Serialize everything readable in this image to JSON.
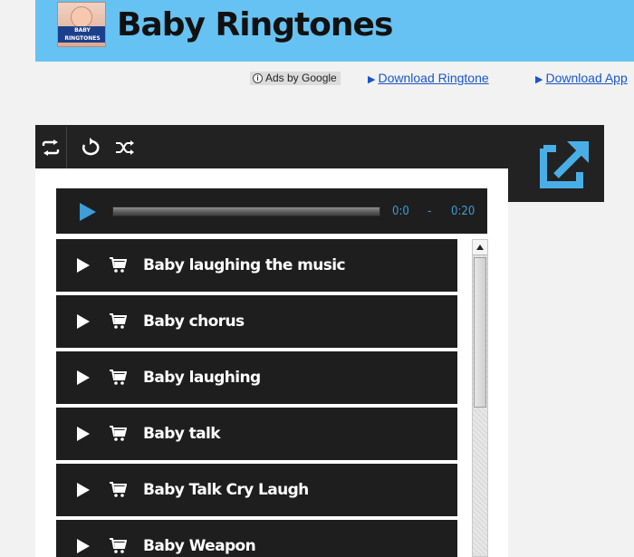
{
  "site": {
    "title": "Baby Ringtones",
    "logo_text": "Baby Ringtones"
  },
  "ads": {
    "badge_label": "Ads by Google",
    "links": [
      {
        "label": "Download Ringtone"
      },
      {
        "label": "Download App"
      }
    ]
  },
  "player": {
    "controls": {
      "repeat_icon": "repeat-icon",
      "replay_icon": "replay-icon",
      "shuffle_icon": "shuffle-icon",
      "external_icon": "external-link-icon"
    },
    "audio": {
      "current_time": "0:0",
      "separator": "-",
      "duration": "0:20",
      "progress_fraction": 0
    },
    "tracks": [
      {
        "title": "Baby laughing the music"
      },
      {
        "title": "Baby chorus"
      },
      {
        "title": "Baby laughing"
      },
      {
        "title": "Baby talk"
      },
      {
        "title": "Baby Talk Cry Laugh"
      },
      {
        "title": "Baby Weapon"
      }
    ]
  },
  "colors": {
    "header_bg": "#66c2f2",
    "player_bg": "#222222",
    "accent_blue": "#3d9ed8",
    "link_blue": "#1a56c9"
  }
}
